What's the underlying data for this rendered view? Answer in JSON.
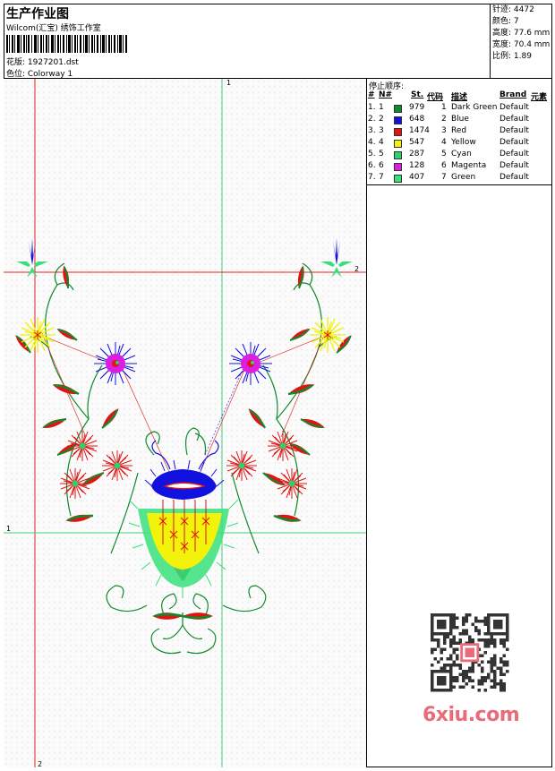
{
  "header": {
    "title": "生产作业图",
    "company": "Wilcom(汇宝) 绣饰工作室",
    "design_label": "花版: 1927201.dst",
    "colorway_label": "色位: Colorway 1"
  },
  "stats": {
    "stitches": "针迹: 4472",
    "colors": "颜色: 7",
    "height": "高度: 77.6 mm",
    "width": "宽度: 70.4 mm",
    "scale": "比例: 1.89"
  },
  "stop_sequence": {
    "title": "停止顺序:",
    "headers": {
      "num": "#",
      "no": "N#",
      "st": "St.",
      "code": "代码",
      "desc": "描述",
      "brand": "Brand",
      "element": "元素"
    },
    "rows": [
      {
        "num": "1.",
        "no": "1",
        "st": "979",
        "code": "1",
        "desc": "Dark Green",
        "brand": "Default",
        "color": "#0f8a2c"
      },
      {
        "num": "2.",
        "no": "2",
        "st": "648",
        "code": "2",
        "desc": "Blue",
        "brand": "Default",
        "color": "#1212e0"
      },
      {
        "num": "3.",
        "no": "3",
        "st": "1474",
        "code": "3",
        "desc": "Red",
        "brand": "Default",
        "color": "#e01414"
      },
      {
        "num": "4.",
        "no": "4",
        "st": "547",
        "code": "4",
        "desc": "Yellow",
        "brand": "Default",
        "color": "#f2f20a"
      },
      {
        "num": "5.",
        "no": "5",
        "st": "287",
        "code": "5",
        "desc": "Cyan",
        "brand": "Default",
        "color": "#2ed26a"
      },
      {
        "num": "6.",
        "no": "6",
        "st": "128",
        "code": "6",
        "desc": "Magenta",
        "brand": "Default",
        "color": "#dd1ee0"
      },
      {
        "num": "7.",
        "no": "7",
        "st": "407",
        "code": "7",
        "desc": "Green",
        "brand": "Default",
        "color": "#37e07a"
      }
    ]
  },
  "guides": {
    "v1": "1",
    "v2": "2",
    "h1": "1",
    "h2": "2"
  },
  "watermark": "6xiu.com",
  "colors": {
    "guide_red": "#e02020",
    "guide_green": "#3cd07a"
  }
}
